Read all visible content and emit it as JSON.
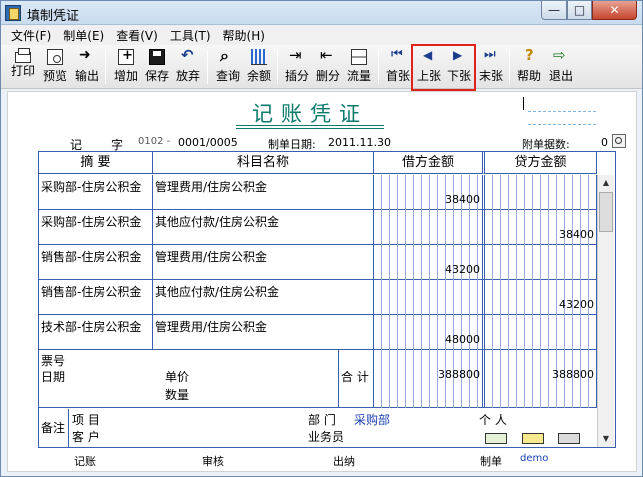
{
  "window": {
    "title": "填制凭证"
  },
  "menu": [
    "文件(F)",
    "制单(E)",
    "查看(V)",
    "工具(T)",
    "帮助(H)"
  ],
  "toolbar": {
    "print": "打印",
    "preview": "预览",
    "export": "输出",
    "add": "增加",
    "save": "保存",
    "discard": "放弃",
    "query": "查询",
    "balance": "余额",
    "insert_row": "插分",
    "delete_row": "删分",
    "cashflow": "流量",
    "first": "首张",
    "prev": "上张",
    "next": "下张",
    "last": "末张",
    "help": "帮助",
    "exit": "退出"
  },
  "voucher": {
    "title": "记账凭证",
    "type_label": "记",
    "zi_label": "字",
    "voucher_code": "0102 -",
    "voucher_no": "0001/0005",
    "date_label": "制单日期:",
    "date": "2011.11.30",
    "attach_label": "附单据数:",
    "attach_count": "0",
    "col_summary": "摘 要",
    "col_account": "科目名称",
    "col_debit": "借方金额",
    "col_credit": "贷方金额",
    "rows": [
      {
        "summary": "采购部-住房公积金",
        "account": "管理费用/住房公积金",
        "debit": "38400",
        "credit": ""
      },
      {
        "summary": "采购部-住房公积金",
        "account": "其他应付款/住房公积金",
        "debit": "",
        "credit": "38400"
      },
      {
        "summary": "销售部-住房公积金",
        "account": "管理费用/住房公积金",
        "debit": "43200",
        "credit": ""
      },
      {
        "summary": "销售部-住房公积金",
        "account": "其他应付款/住房公积金",
        "debit": "",
        "credit": "43200"
      },
      {
        "summary": "技术部-住房公积金",
        "account": "管理费用/住房公积金",
        "debit": "48000",
        "credit": ""
      }
    ],
    "bill_no_label": "票号",
    "bill_date_label": "日期",
    "unit_price_label": "单价",
    "quantity_label": "数量",
    "total_label": "合 计",
    "total_debit": "388800",
    "total_credit": "388800",
    "remark_label": "备注",
    "project_label": "项 目",
    "customer_label": "客 户",
    "dept_label": "部 门",
    "dept_value": "采购部",
    "person_label": "个 人",
    "salesman_label": "业务员",
    "bookkeeper_label": "记账",
    "auditor_label": "审核",
    "cashier_label": "出纳",
    "maker_label": "制单",
    "maker_value": "demo"
  },
  "colors": {
    "accent": "#0a7a6a",
    "grid": "#3a5fb0",
    "highlight": "#e0231a",
    "link": "#1a3fb0"
  }
}
